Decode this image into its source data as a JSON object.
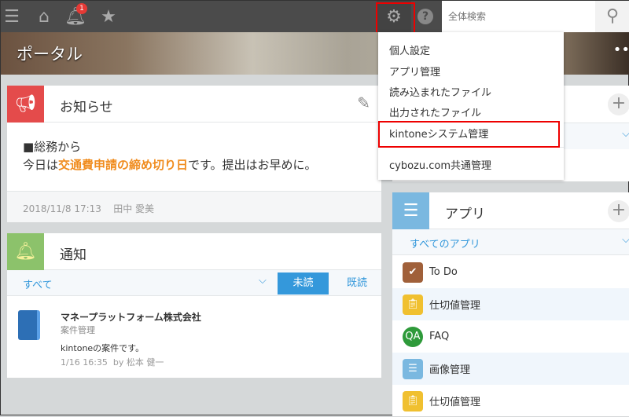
{
  "topbar": {
    "notification_count": "1",
    "search_placeholder": "全体検索"
  },
  "banner": {
    "title": "ポータル"
  },
  "menu": {
    "items": [
      "個人設定",
      "アプリ管理",
      "読み込まれたファイル",
      "出力されたファイル",
      "kintoneシステム管理",
      "cybozu.com共通管理"
    ]
  },
  "announcement": {
    "title": "お知らせ",
    "line1": "■総務から",
    "line2_pre": "今日は",
    "line2_highlight": "交通費申請の締め切り日",
    "line2_post": "です。提出はお早めに。",
    "date": "2018/11/8 17:13",
    "author": "田中 愛美",
    "highlight_color": "#f08c1e"
  },
  "notifications": {
    "title": "通知",
    "filter": "すべて",
    "tab_unread": "未読",
    "tab_read": "既読",
    "item": {
      "title": "マネープラットフォーム株式会社",
      "app": "案件管理",
      "body": "kintoneの案件です。",
      "meta": "1/16 16:35  by 松本 健一"
    }
  },
  "apps": {
    "title": "アプリ",
    "filter": "すべてのアプリ",
    "items": [
      {
        "name": "To Do"
      },
      {
        "name": "仕切値管理"
      },
      {
        "name": "FAQ"
      },
      {
        "name": "画像管理"
      },
      {
        "name": "仕切値管理"
      }
    ]
  },
  "colors": {
    "accent": "#3498db",
    "highlight": "#e00000"
  }
}
